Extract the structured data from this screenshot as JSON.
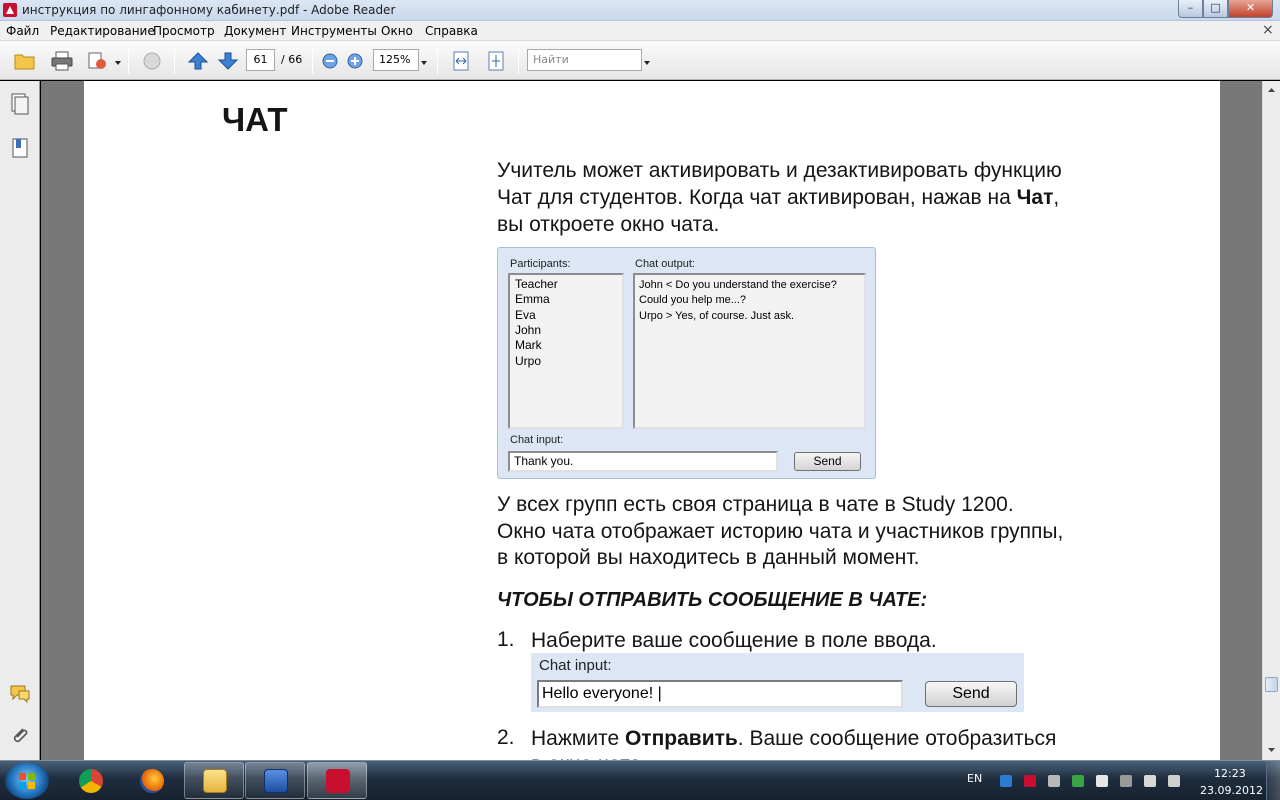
{
  "window": {
    "title": "инструкция по лингафонному кабинету.pdf - Adobe Reader",
    "min": "–",
    "max": "□",
    "close": "✕"
  },
  "menu": [
    "Файл",
    "Редактирование",
    "Просмотр",
    "Документ",
    "Инструменты",
    "Окно",
    "Справка"
  ],
  "menu_close": "×",
  "toolbar": {
    "page_current": "61",
    "page_total": "/ 66",
    "zoom": "125%",
    "search_placeholder": "Найти"
  },
  "document": {
    "heading": "ЧАТ",
    "para1": [
      "Учитель может активировать и дезактивировать функцию",
      "Чат для студентов. Когда чат активирован, нажав на ",
      "Чат",
      ",",
      "вы откроете окно чата."
    ],
    "chat_window": {
      "participants_label": "Participants:",
      "participants": [
        "Teacher",
        "Emma",
        "Eva",
        "John",
        "Mark",
        "Urpo"
      ],
      "output_label": "Chat output:",
      "output": [
        "John <  Do you understand the exercise?",
        "Could you help me...?",
        " Urpo > Yes, of course. Just ask."
      ],
      "input_label": "Chat input:",
      "input_value": "Thank you.",
      "send": "Send"
    },
    "para2": [
      "У всех групп есть своя страница в чате в Study 1200.",
      "Окно чата отображает историю чата и участников группы,",
      "в которой вы находитесь в данный момент."
    ],
    "subheading": "ЧТОБЫ ОТПРАВИТЬ СООБЩЕНИЕ В ЧАТЕ:",
    "step1_num": "1.",
    "step1": "Наберите ваше сообщение в поле ввода.",
    "strip": {
      "label": "Chat input:",
      "value": "Hello everyone! |",
      "send": "Send"
    },
    "step2_num": "2.",
    "step2": [
      "Нажмите ",
      "Отправить",
      ". Ваше сообщение отобразиться",
      "в окне чата."
    ]
  },
  "taskbar": {
    "lang": "EN",
    "time": "12:23",
    "date": "23.09.2012"
  },
  "colors": {
    "accent": "#dce6f4",
    "adobe_red": "#c8102e",
    "doc_bg": "#787878"
  }
}
